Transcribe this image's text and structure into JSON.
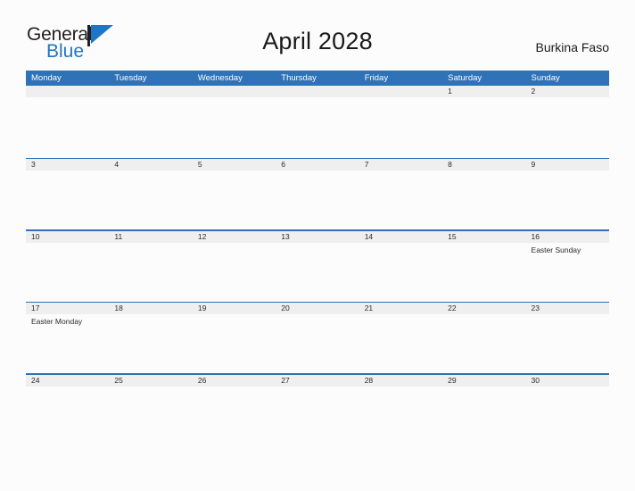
{
  "header": {
    "logo": {
      "word_one": "General",
      "word_two": "Blue",
      "flag_icon": "blue-triangle-flag-icon",
      "word_one_color": "#231f20",
      "word_two_color": "#2076c4"
    },
    "title": "April 2028",
    "subtitle": "Burkina Faso"
  },
  "theme": {
    "header_blue": "#2e72b8",
    "band_gray": "#efefef",
    "page_background": "#fcfcfc",
    "text_color": "#2b2b2b"
  },
  "calendar": {
    "weekdays": [
      "Monday",
      "Tuesday",
      "Wednesday",
      "Thursday",
      "Friday",
      "Saturday",
      "Sunday"
    ],
    "weeks": [
      [
        {
          "day": ""
        },
        {
          "day": ""
        },
        {
          "day": ""
        },
        {
          "day": ""
        },
        {
          "day": ""
        },
        {
          "day": "1",
          "event": ""
        },
        {
          "day": "2",
          "event": ""
        }
      ],
      [
        {
          "day": "3",
          "event": ""
        },
        {
          "day": "4",
          "event": ""
        },
        {
          "day": "5",
          "event": ""
        },
        {
          "day": "6",
          "event": ""
        },
        {
          "day": "7",
          "event": ""
        },
        {
          "day": "8",
          "event": ""
        },
        {
          "day": "9",
          "event": ""
        }
      ],
      [
        {
          "day": "10",
          "event": ""
        },
        {
          "day": "11",
          "event": ""
        },
        {
          "day": "12",
          "event": ""
        },
        {
          "day": "13",
          "event": ""
        },
        {
          "day": "14",
          "event": ""
        },
        {
          "day": "15",
          "event": ""
        },
        {
          "day": "16",
          "event": "Easter Sunday"
        }
      ],
      [
        {
          "day": "17",
          "event": "Easter Monday"
        },
        {
          "day": "18",
          "event": ""
        },
        {
          "day": "19",
          "event": ""
        },
        {
          "day": "20",
          "event": ""
        },
        {
          "day": "21",
          "event": ""
        },
        {
          "day": "22",
          "event": ""
        },
        {
          "day": "23",
          "event": ""
        }
      ],
      [
        {
          "day": "24",
          "event": ""
        },
        {
          "day": "25",
          "event": ""
        },
        {
          "day": "26",
          "event": ""
        },
        {
          "day": "27",
          "event": ""
        },
        {
          "day": "28",
          "event": ""
        },
        {
          "day": "29",
          "event": ""
        },
        {
          "day": "30",
          "event": ""
        }
      ]
    ]
  }
}
